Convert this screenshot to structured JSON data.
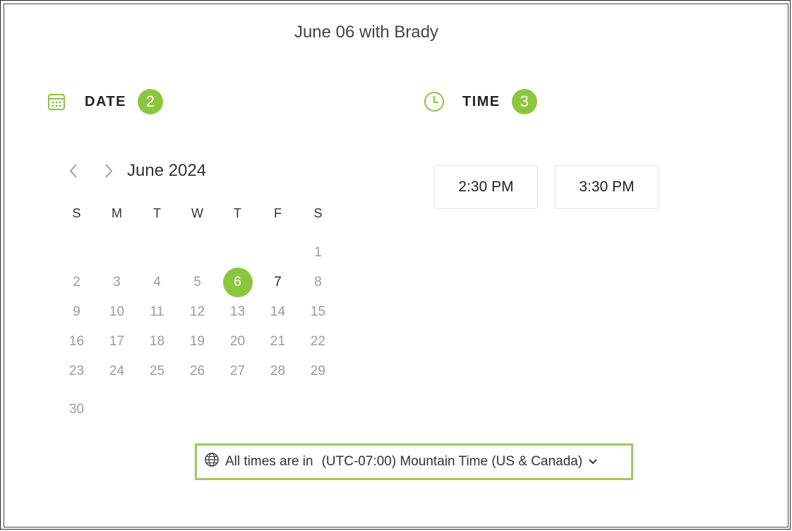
{
  "title": "June 06 with Brady",
  "date_section": {
    "label": "DATE",
    "step": "2",
    "icon": "calendar-icon"
  },
  "time_section": {
    "label": "TIME",
    "step": "3",
    "icon": "clock-icon"
  },
  "calendar": {
    "month": "June 2024",
    "weekdays": [
      "S",
      "M",
      "T",
      "W",
      "T",
      "F",
      "S"
    ],
    "selected_day": "6",
    "available_days": [
      "6",
      "7"
    ],
    "weeks": [
      [
        "",
        "",
        "",
        "",
        "",
        "",
        "1"
      ],
      [
        "2",
        "3",
        "4",
        "5",
        "6",
        "7",
        "8"
      ],
      [
        "9",
        "10",
        "11",
        "12",
        "13",
        "14",
        "15"
      ],
      [
        "16",
        "17",
        "18",
        "19",
        "20",
        "21",
        "22"
      ],
      [
        "23",
        "24",
        "25",
        "26",
        "27",
        "28",
        "29"
      ],
      [
        "30",
        "",
        "",
        "",
        "",
        "",
        ""
      ]
    ]
  },
  "time_slots": [
    "2:30 PM",
    "3:30 PM"
  ],
  "timezone": {
    "prefix": "All times are in",
    "value": "(UTC-07:00) Mountain Time (US & Canada)",
    "icon": "globe-icon"
  },
  "colors": {
    "accent": "#8cc63f",
    "tz_border": "#9acd5a",
    "muted_day": "#9b9b9b"
  }
}
